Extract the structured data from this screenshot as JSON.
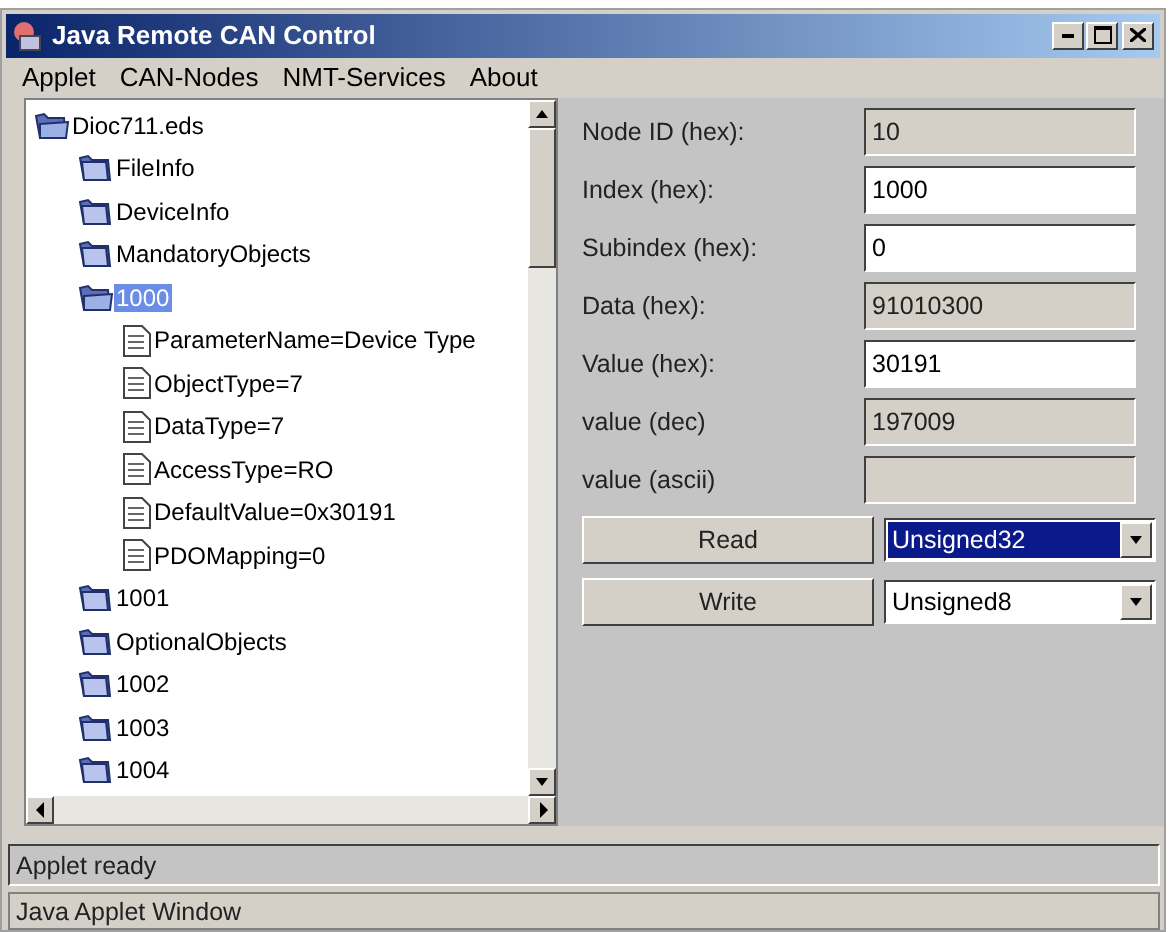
{
  "window": {
    "title": "Java Remote CAN Control"
  },
  "menu": [
    "Applet",
    "CAN-Nodes",
    "NMT-Services",
    "About"
  ],
  "tree": [
    {
      "label": "Dioc711.eds",
      "kind": "folder",
      "expanded": true,
      "selected": false,
      "children": [
        {
          "label": "FileInfo",
          "kind": "folder",
          "expanded": false,
          "selected": false
        },
        {
          "label": "DeviceInfo",
          "kind": "folder",
          "expanded": false,
          "selected": false
        },
        {
          "label": "MandatoryObjects",
          "kind": "folder",
          "expanded": false,
          "selected": false
        },
        {
          "label": "1000",
          "kind": "folder",
          "expanded": true,
          "selected": true,
          "children": [
            {
              "label": "ParameterName=Device Type",
              "kind": "leaf",
              "selected": false
            },
            {
              "label": "ObjectType=7",
              "kind": "leaf",
              "selected": false
            },
            {
              "label": "DataType=7",
              "kind": "leaf",
              "selected": false
            },
            {
              "label": "AccessType=RO",
              "kind": "leaf",
              "selected": false
            },
            {
              "label": "DefaultValue=0x30191",
              "kind": "leaf",
              "selected": false
            },
            {
              "label": "PDOMapping=0",
              "kind": "leaf",
              "selected": false
            }
          ]
        },
        {
          "label": "1001",
          "kind": "folder",
          "expanded": false,
          "selected": false
        },
        {
          "label": "OptionalObjects",
          "kind": "folder",
          "expanded": false,
          "selected": false
        },
        {
          "label": "1002",
          "kind": "folder",
          "expanded": false,
          "selected": false
        },
        {
          "label": "1003",
          "kind": "folder",
          "expanded": false,
          "selected": false
        },
        {
          "label": "1004",
          "kind": "folder",
          "expanded": false,
          "selected": false
        }
      ]
    }
  ],
  "fields": [
    {
      "label": "Node ID (hex):",
      "value": "10",
      "disabled": true
    },
    {
      "label": "Index (hex):",
      "value": "1000",
      "disabled": false
    },
    {
      "label": "Subindex (hex):",
      "value": "0",
      "disabled": false
    },
    {
      "label": "Data (hex):",
      "value": "91010300",
      "disabled": true
    },
    {
      "label": "Value (hex):",
      "value": "30191",
      "disabled": false
    },
    {
      "label": "value (dec)",
      "value": "197009",
      "disabled": true
    },
    {
      "label": "value (ascii)",
      "disabled": true
    }
  ],
  "actions": [
    {
      "button": "Read",
      "type": "Unsigned32",
      "focused": true
    },
    {
      "button": "Write",
      "type": "Unsigned8",
      "focused": false
    }
  ],
  "status": "Applet ready",
  "footer": "Java Applet Window"
}
